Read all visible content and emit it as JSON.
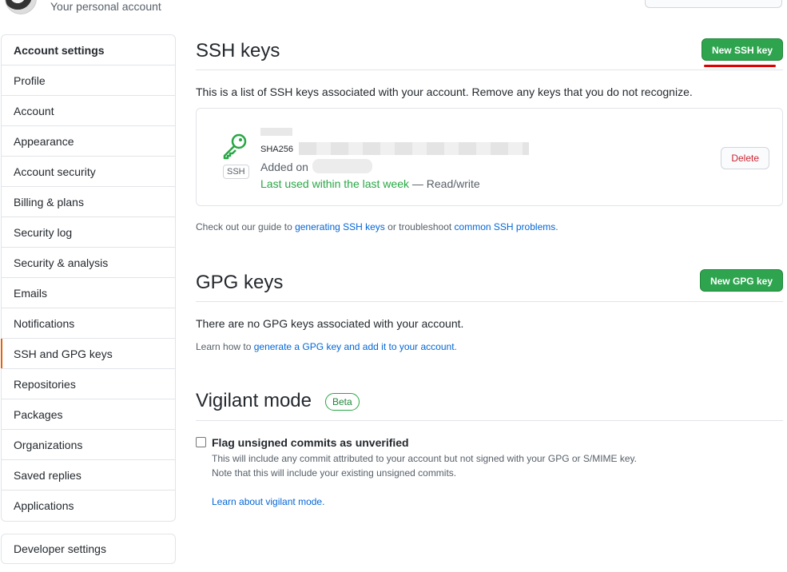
{
  "header": {
    "subtitle": "Your personal account"
  },
  "sidebar": {
    "heading": "Account settings",
    "items": [
      {
        "label": "Profile"
      },
      {
        "label": "Account"
      },
      {
        "label": "Appearance"
      },
      {
        "label": "Account security"
      },
      {
        "label": "Billing & plans"
      },
      {
        "label": "Security log"
      },
      {
        "label": "Security & analysis"
      },
      {
        "label": "Emails"
      },
      {
        "label": "Notifications"
      },
      {
        "label": "SSH and GPG keys",
        "selected": true
      },
      {
        "label": "Repositories"
      },
      {
        "label": "Packages"
      },
      {
        "label": "Organizations"
      },
      {
        "label": "Saved replies"
      },
      {
        "label": "Applications"
      }
    ],
    "developer_settings": "Developer settings"
  },
  "ssh": {
    "title": "SSH keys",
    "new_button": "New SSH key",
    "description": "This is a list of SSH keys associated with your account. Remove any keys that you do not recognize.",
    "key": {
      "type_label": "SSH",
      "fingerprint_prefix": "SHA256",
      "added_label": "Added on",
      "last_used": "Last used within the last week",
      "access": " — Read/write",
      "delete_label": "Delete"
    },
    "guide": {
      "prefix": "Check out our guide to ",
      "link1": "generating SSH keys",
      "middle": " or troubleshoot ",
      "link2": "common SSH problems",
      "suffix": "."
    }
  },
  "gpg": {
    "title": "GPG keys",
    "new_button": "New GPG key",
    "empty_text": "There are no GPG keys associated with your account.",
    "learn": {
      "prefix": "Learn how to ",
      "link": "generate a GPG key and add it to your account",
      "suffix": "."
    }
  },
  "vigilant": {
    "title": "Vigilant mode",
    "badge": "Beta",
    "checkbox_label": "Flag unsigned commits as unverified",
    "checked": false,
    "note1": "This will include any commit attributed to your account but not signed with your GPG or S/MIME key.",
    "note2": "Note that this will include your existing unsigned commits.",
    "learn_link": "Learn about vigilant mode."
  },
  "colors": {
    "primary_green": "#2ea44f",
    "link_blue": "#0366d6",
    "danger_red": "#cb2431",
    "annotation_red": "#e00000"
  }
}
